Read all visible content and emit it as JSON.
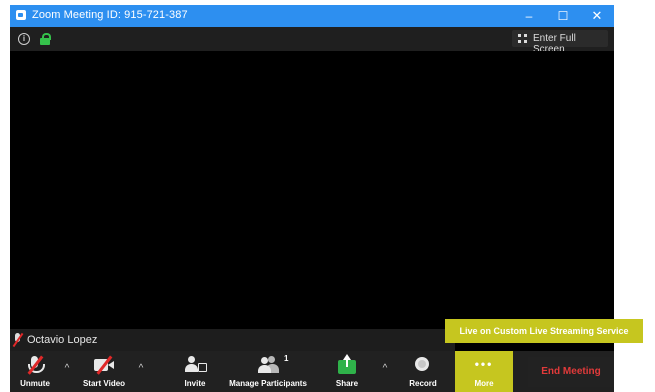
{
  "window": {
    "title": "Zoom Meeting ID: 915-721-387",
    "controls": {
      "minimize": "–",
      "maximize": "☐",
      "close": "✕"
    }
  },
  "infobar": {
    "info_icon": "info-icon",
    "lock_icon": "lock-icon",
    "fullscreen_label": "Enter Full Screen"
  },
  "participant": {
    "name": "Octavio Lopez",
    "mic_state_icon": "mic-muted-icon"
  },
  "live_banner": "Live on Custom Live Streaming Service",
  "toolbar": {
    "unmute_label": "Unmute",
    "start_video_label": "Start Video",
    "invite_label": "Invite",
    "manage_participants_label": "Manage Participants",
    "participant_count": "1",
    "share_label": "Share",
    "record_label": "Record",
    "more_label": "More",
    "more_dots": "•••",
    "end_meeting_label": "End Meeting",
    "caret": "^"
  },
  "colors": {
    "titlebar": "#2d8ff0",
    "highlight": "#c6c61f",
    "end_meeting_text": "#e13a3a",
    "share_green": "#2fb24a",
    "lock_green": "#35c24b"
  }
}
